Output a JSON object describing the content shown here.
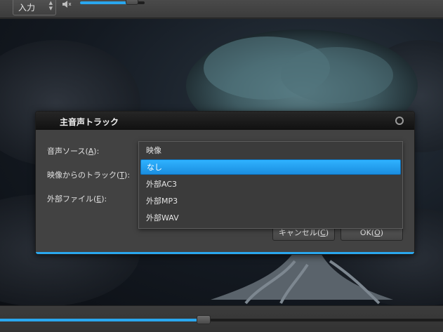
{
  "toolbar": {
    "input_label": "入力",
    "volume_level": 0.8
  },
  "seek": {
    "position": 0.46
  },
  "dialog": {
    "title": "主音声トラック",
    "fields": [
      {
        "label_before": "音声ソース(",
        "mnemonic": "A",
        "label_after": "):"
      },
      {
        "label_before": "映像からのトラック(",
        "mnemonic": "T",
        "label_after": "):"
      },
      {
        "label_before": "外部ファイル(",
        "mnemonic": "E",
        "label_after": "):"
      }
    ],
    "cancel": {
      "label_before": "キャンセル(",
      "mnemonic": "C",
      "label_after": ")"
    },
    "ok": {
      "label_before": "OK(",
      "mnemonic": "O",
      "label_after": ")"
    }
  },
  "dropdown": {
    "options": [
      "映像",
      "なし",
      "外部AC3",
      "外部MP3",
      "外部WAV"
    ],
    "selected_index": 1
  },
  "colors": {
    "accent": "#2aa7ee"
  }
}
